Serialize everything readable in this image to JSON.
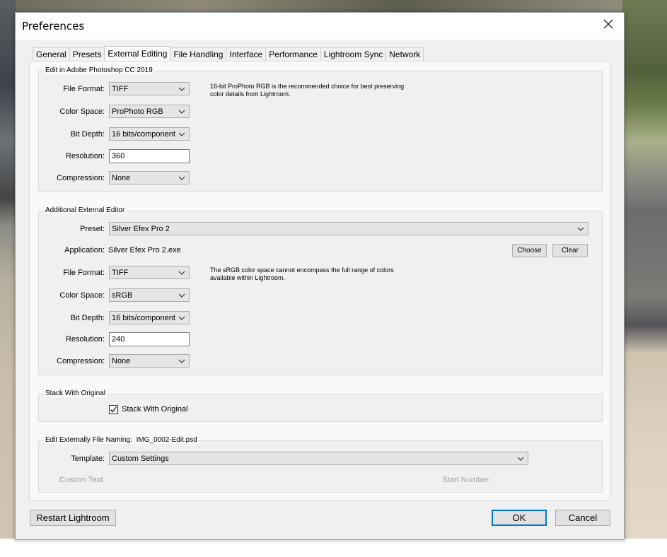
{
  "dialog": {
    "title": "Preferences"
  },
  "tabs": [
    "General",
    "Presets",
    "External Editing",
    "File Handling",
    "Interface",
    "Performance",
    "Lightroom Sync",
    "Network"
  ],
  "photoshop": {
    "legend": "Edit in Adobe Photoshop CC 2019",
    "file_format_label": "File Format:",
    "file_format": "TIFF",
    "color_space_label": "Color Space:",
    "color_space": "ProPhoto RGB",
    "bit_depth_label": "Bit Depth:",
    "bit_depth": "16 bits/component",
    "resolution_label": "Resolution:",
    "resolution": "360",
    "compression_label": "Compression:",
    "compression": "None",
    "note": "16-bit ProPhoto RGB is the recommended choice for best preserving color details from Lightroom."
  },
  "additional": {
    "legend": "Additional External Editor",
    "preset_label": "Preset:",
    "preset": "Silver Efex Pro 2",
    "application_label": "Application:",
    "application": "Silver Efex Pro 2.exe",
    "choose_label": "Choose",
    "clear_label": "Clear",
    "file_format_label": "File Format:",
    "file_format": "TIFF",
    "color_space_label": "Color Space:",
    "color_space": "sRGB",
    "bit_depth_label": "Bit Depth:",
    "bit_depth": "16 bits/component",
    "resolution_label": "Resolution:",
    "resolution": "240",
    "compression_label": "Compression:",
    "compression": "None",
    "note": "The sRGB color space cannot encompass the full range of colors available within Lightroom."
  },
  "stack": {
    "legend": "Stack With Original",
    "checkbox_label": "Stack With Original",
    "checked": true
  },
  "naming": {
    "legend": "Edit Externally File Naming:",
    "example": "IMG_0002-Edit.psd",
    "template_label": "Template:",
    "template": "Custom Settings",
    "custom_text_label": "Custom Text:",
    "start_number_label": "Start Number:"
  },
  "footer": {
    "restart_label": "Restart Lightroom",
    "ok_label": "OK",
    "cancel_label": "Cancel"
  },
  "icons": {
    "close": "close-icon",
    "dropdown": "chevron-down-icon",
    "check": "checkmark-icon"
  },
  "colors": {
    "focus_border": "#0078d7",
    "dialog_bg": "#f0f0f0"
  }
}
